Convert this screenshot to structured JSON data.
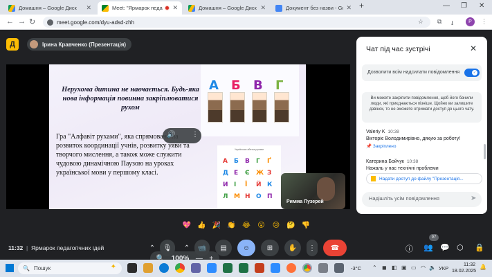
{
  "browser": {
    "tabs": [
      {
        "title": "Домашня – Google Диск",
        "icon": "google-drive-icon",
        "active": false
      },
      {
        "title": "Meet: \"Ярмарок педагогі",
        "icon": "google-meet-icon",
        "active": true,
        "recording": true
      },
      {
        "title": "Домашня – Google Диск",
        "icon": "google-drive-icon",
        "active": false
      },
      {
        "title": "Документ без назви - Googl",
        "icon": "google-docs-icon",
        "active": false
      }
    ],
    "new_tab": "+",
    "url": "meet.google.com/dyu-adsd-zhh",
    "profile_initial": "P"
  },
  "meet": {
    "presenter_label": "Ірина Кравченко (Презентація)",
    "slide": {
      "heading": "Нерухома дитина не навчається. Будь-яка нова інформація повинна закріплюватися рухом",
      "body": "Гра \"Алфавіт рухами\", яка спрямована на розвиток координації учнів, розвитку уяви та творчого мислення, а також може служити чудовою динамічною Паузою на уроках української мови у першому класі.",
      "big_letters": [
        "А",
        "Б",
        "В",
        "Г"
      ],
      "alphabet_caption": "Українська абетка рухами",
      "alphabet_rows": [
        [
          "А",
          "Б",
          "В",
          "Г",
          "Ґ"
        ],
        [
          "Д",
          "Е",
          "Є",
          "Ж",
          "З"
        ],
        [
          "И",
          "І",
          "Ї",
          "Й",
          "К"
        ],
        [
          "Л",
          "М",
          "Н",
          "О",
          "П"
        ]
      ]
    },
    "zoom": {
      "minus": "—",
      "value": "100%",
      "plus": "+"
    },
    "participant_tile": {
      "name": "Римма Пузерей"
    },
    "reactions": [
      "💖",
      "👍",
      "🎉",
      "👏",
      "😂",
      "😮",
      "😢",
      "🤔",
      "👎"
    ],
    "bottom": {
      "time": "11:32",
      "divider": "|",
      "meeting_title": "Ярмарок педагогічних ідей",
      "people_count": "97"
    }
  },
  "chat": {
    "title": "Чат під час зустрічі",
    "allow_label": "Дозволити всім надсилати повідомлення",
    "allow_enabled": true,
    "pin_note": "Ви можете закріпити повідомлення, щоб його бачили люди, які приєднаються пізніше. Щойно ви залишите дзвінок, то не зможете отримати доступ до цього чату.",
    "messages": [
      {
        "author": "Valeriy K",
        "time": "10:38",
        "text": "Вікторіє Володимирівно, дякую за роботу!",
        "pinned_label": "Закріплено"
      },
      {
        "author": "Катерина Бойчук",
        "time": "10:38",
        "text": "Нажаль у нас технічні проблеми"
      }
    ],
    "access_button": "Надати доступ до файлу \"Презентація...",
    "input_placeholder": "Надішліть усім повідомлення"
  },
  "taskbar": {
    "search_label": "Пошук",
    "weather": "-3°C",
    "language": "УКР",
    "time": "11:32",
    "date": "18.02.2025"
  },
  "colors": {
    "meet_background": "#202124",
    "accent_blue": "#1a73e8",
    "leave_red": "#ea4335",
    "active_control": "#8ab4f8"
  }
}
